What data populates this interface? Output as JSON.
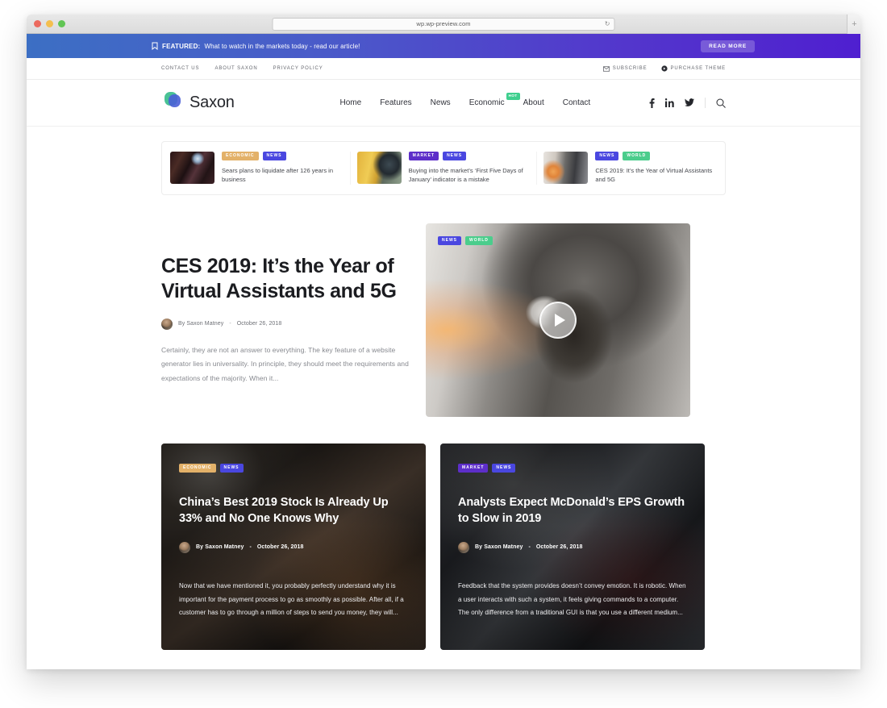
{
  "browser": {
    "url": "wp.wp-preview.com",
    "reload_icon": "reload-icon",
    "new_tab_label": "+"
  },
  "featured_bar": {
    "icon": "bookmark-icon",
    "label": "FEATURED:",
    "text": "What to watch in the markets today  - read our article!",
    "button_label": "READ MORE",
    "gradient_from": "#3c6fc4",
    "gradient_to": "#4f1fd0"
  },
  "top_nav": {
    "left_links": [
      {
        "label": "CONTACT US"
      },
      {
        "label": "ABOUT SAXON"
      },
      {
        "label": "PRIVACY POLICY"
      }
    ],
    "right_links": [
      {
        "label": "SUBSCRIBE",
        "icon": "envelope-icon"
      },
      {
        "label": "PURCHASE THEME",
        "icon": "cart-icon"
      }
    ]
  },
  "masthead": {
    "brand_name": "Saxon",
    "logo_icon": "saxon-logo-icon",
    "nav": [
      {
        "label": "Home",
        "badge": null
      },
      {
        "label": "Features",
        "badge": null
      },
      {
        "label": "News",
        "badge": null
      },
      {
        "label": "Economic",
        "badge": "HOT"
      },
      {
        "label": "About",
        "badge": null
      },
      {
        "label": "Contact",
        "badge": null
      }
    ],
    "social": [
      {
        "name": "facebook-icon"
      },
      {
        "name": "linkedin-icon"
      },
      {
        "name": "twitter-icon"
      }
    ],
    "search_icon": "search-icon",
    "hot_badge_color": "#3ecf8e"
  },
  "top_stories": [
    {
      "badges": [
        {
          "label": "ECONOMIC",
          "color": "#e3b169",
          "cls": "economic"
        },
        {
          "label": "NEWS",
          "color": "#4a47e0",
          "cls": "news"
        }
      ],
      "title": "Sears plans to liquidate after 126 years in business"
    },
    {
      "badges": [
        {
          "label": "MARKET",
          "color": "#5d2ec9",
          "cls": "market"
        },
        {
          "label": "NEWS",
          "color": "#4a47e0",
          "cls": "news"
        }
      ],
      "title": "Buying into the market’s ‘First Five Days of January’ indicator is a mistake"
    },
    {
      "badges": [
        {
          "label": "NEWS",
          "color": "#4a47e0",
          "cls": "news"
        },
        {
          "label": "WORLD",
          "color": "#4bcd8c",
          "cls": "world"
        }
      ],
      "title": "CES 2019: It’s the Year of Virtual Assistants and 5G"
    }
  ],
  "hero": {
    "title": "CES 2019: It’s the Year of Virtual Assistants and 5G",
    "author": "By Saxon Matney",
    "separator": "-",
    "date": "October 26, 2018",
    "excerpt": "Certainly, they are not an answer to everything. The key feature of a website generator lies in universality. In principle, they should meet the requirements and expectations of the majority. When it...",
    "badges": [
      {
        "label": "NEWS",
        "cls": "news"
      },
      {
        "label": "WORLD",
        "cls": "world"
      }
    ],
    "play_icon": "play-icon"
  },
  "cards": [
    {
      "badges": [
        {
          "label": "ECONOMIC",
          "cls": "economic"
        },
        {
          "label": "NEWS",
          "cls": "news"
        }
      ],
      "title": "China’s Best 2019 Stock Is Already Up 33% and No One Knows Why",
      "author": "By Saxon Matney",
      "separator": "-",
      "date": "October 26, 2018",
      "excerpt": "Now that we have mentioned it, you probably perfectly understand why it is important for the payment process to go as smoothly as possible. After all, if a customer has to go through a million of steps to send you money, they will..."
    },
    {
      "badges": [
        {
          "label": "MARKET",
          "cls": "market"
        },
        {
          "label": "NEWS",
          "cls": "news"
        }
      ],
      "title": "Analysts Expect McDonald’s EPS Growth to Slow in 2019",
      "author": "By Saxon Matney",
      "separator": "-",
      "date": "October 26, 2018",
      "excerpt": "Feedback that the system provides doesn’t convey emotion. It is robotic. When a user interacts with such a system, it feels giving commands to a computer. The only difference from a traditional GUI is that you use a different medium..."
    }
  ]
}
